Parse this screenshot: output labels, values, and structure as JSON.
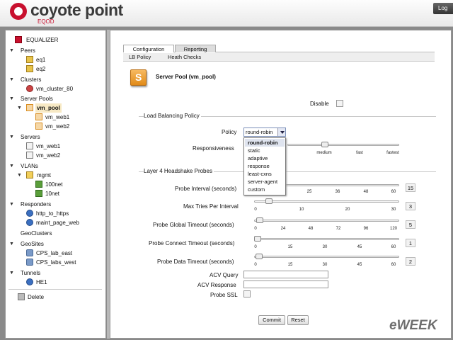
{
  "header": {
    "brand": "coyote point",
    "product": "EQOD",
    "logout": "Log"
  },
  "tree": [
    {
      "label": "EQUALIZER",
      "icon": "equalizer-icon"
    },
    {
      "label": "Peers"
    },
    {
      "label": "eq1",
      "icon": "peer-icon"
    },
    {
      "label": "eq2",
      "icon": "peer-icon"
    },
    {
      "label": "Clusters"
    },
    {
      "label": "vm_cluster_80",
      "icon": "cluster-icon"
    },
    {
      "label": "Server Pools"
    },
    {
      "label": "vm_pool",
      "icon": "server-pool-icon",
      "selected": true
    },
    {
      "label": "vm_web1",
      "icon": "server-instance-icon"
    },
    {
      "label": "vm_web2",
      "icon": "server-instance-icon"
    },
    {
      "label": "Servers"
    },
    {
      "label": "vm_web1",
      "icon": "server-icon"
    },
    {
      "label": "vm_web2",
      "icon": "server-icon"
    },
    {
      "label": "VLANs"
    },
    {
      "label": "mgmt",
      "icon": "vlan-icon"
    },
    {
      "label": "100net",
      "icon": "subnet-icon"
    },
    {
      "label": "10net",
      "icon": "subnet-icon"
    },
    {
      "label": "Responders"
    },
    {
      "label": "http_to_https",
      "icon": "responder-icon"
    },
    {
      "label": "maint_page_web",
      "icon": "responder-icon"
    },
    {
      "label": "GeoClusters"
    },
    {
      "label": "GeoSites"
    },
    {
      "label": "CPS_lab_east",
      "icon": "geosite-icon"
    },
    {
      "label": "CPS_labs_west",
      "icon": "geosite-icon"
    },
    {
      "label": "Tunnels"
    },
    {
      "label": "HE1",
      "icon": "tunnel-icon"
    },
    {
      "label": "Delete",
      "icon": "trash-icon"
    }
  ],
  "tabs": {
    "configuration": "Configuration",
    "reporting": "Reporting"
  },
  "subtabs": {
    "lb_policy": "LB Policy",
    "health_checks": "Heath Checks"
  },
  "pool_title": "Server Pool (vm_pool)",
  "disable_label": "Disable",
  "lb_section": {
    "legend": "Load Balancing Policy",
    "policy_label": "Policy",
    "policy_value": "round-robin",
    "policy_options": [
      "round-robin",
      "static",
      "adaptive",
      "response",
      "least-cxns",
      "server-agent",
      "custom"
    ],
    "responsiveness_label": "Responsiveness",
    "responsiveness_ticks": [
      "medium",
      "fast",
      "fastest"
    ]
  },
  "probes": {
    "legend": "Layer 4 Headshake Probes",
    "rows": [
      {
        "label": "Probe Interval (seconds)",
        "ticks": [
          "25",
          "36",
          "48",
          "60"
        ],
        "value": "15"
      },
      {
        "label": "Max Tries Per Interval",
        "ticks": [
          "0",
          "10",
          "20",
          "30"
        ],
        "value": "3"
      },
      {
        "label": "Probe Global Timeout (seconds)",
        "ticks": [
          "0",
          "24",
          "48",
          "72",
          "96",
          "120"
        ],
        "value": "5"
      },
      {
        "label": "Probe Connect Timeout (seconds)",
        "ticks": [
          "0",
          "15",
          "30",
          "45",
          "60"
        ],
        "value": "1"
      },
      {
        "label": "Probe Data Timeout (seconds)",
        "ticks": [
          "0",
          "15",
          "30",
          "45",
          "60"
        ],
        "value": "2"
      }
    ],
    "acv_query_label": "ACV Query",
    "acv_response_label": "ACV Response",
    "probe_ssl_label": "Probe SSL"
  },
  "buttons": {
    "commit": "Commit",
    "reset": "Reset"
  },
  "watermark": "eWEEK"
}
